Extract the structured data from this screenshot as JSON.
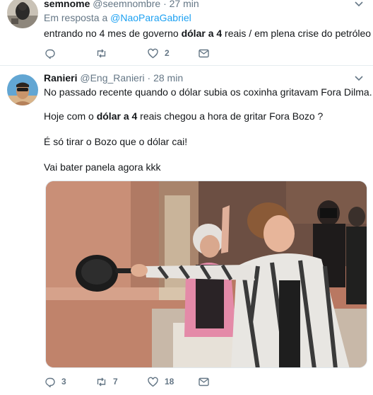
{
  "tweet1": {
    "name": "semnome",
    "handle": "@seemnombre",
    "dot": "·",
    "time": "27 min",
    "reply_prefix": "Em resposta a",
    "reply_handle": "@NaoParaGabriel",
    "text_before": "entrando no 4 mes de governo ",
    "text_bold": "dólar a 4",
    "text_after": " reais / em plena crise do petróleo",
    "reply_count": "",
    "retweet_count": "",
    "like_count": "2",
    "icons": [
      "reply-icon",
      "retweet-icon",
      "heart-icon",
      "message-icon",
      "chevron-down-icon"
    ]
  },
  "tweet2": {
    "name": "Ranieri",
    "handle": "@Eng_Ranieri",
    "dot": "·",
    "time": "28 min",
    "line1": "No passado recente quando o dólar subia os coxinha gritavam Fora Dilma.",
    "line2_before": "Hoje com o ",
    "line2_bold": "dólar a 4",
    "line2_after": " reais chegou a hora de gritar Fora Bozo ?",
    "line3": "É só tirar o Bozo que o dólar cai!",
    "line4": "Vai bater panela agora kkk",
    "reply_count": "3",
    "retweet_count": "7",
    "like_count": "18",
    "icons": [
      "reply-icon",
      "retweet-icon",
      "heart-icon",
      "message-icon",
      "chevron-down-icon"
    ]
  },
  "colors": {
    "link": "#1da1f2",
    "secondary_text": "#657786",
    "primary_text": "#14171a",
    "divider": "#e6ecf0"
  }
}
